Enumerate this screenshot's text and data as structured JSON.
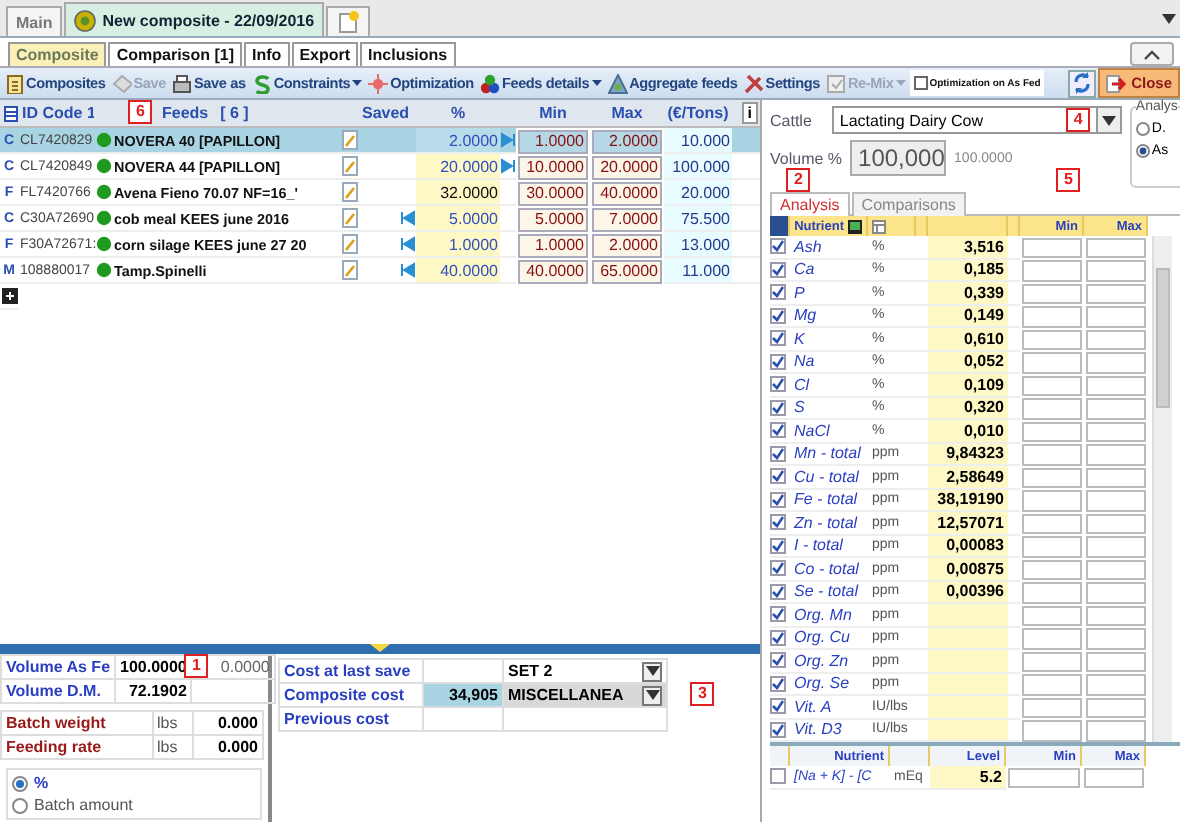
{
  "top_tabs": [
    {
      "label": "Main",
      "selected": false
    },
    {
      "label": "New composite - 22/09/2016",
      "selected": true
    }
  ],
  "sub_tabs": [
    {
      "label": "Composite",
      "selected": true
    },
    {
      "label": "Comparison [1]",
      "selected": false
    },
    {
      "label": "Info",
      "selected": false
    },
    {
      "label": "Export",
      "selected": false
    },
    {
      "label": "Inclusions",
      "selected": false
    }
  ],
  "toolbar": {
    "items": [
      {
        "label": "Composites",
        "kind": "composites",
        "disabled": false,
        "dropdown": false
      },
      {
        "label": "Save",
        "kind": "save",
        "disabled": true,
        "dropdown": false
      },
      {
        "label": "Save as",
        "kind": "saveas",
        "disabled": false,
        "dropdown": false
      },
      {
        "label": "Constraints",
        "kind": "constraints",
        "disabled": false,
        "dropdown": true
      },
      {
        "label": "Optimization",
        "kind": "optimization",
        "disabled": false,
        "dropdown": false
      },
      {
        "label": "Feeds details",
        "kind": "details",
        "disabled": false,
        "dropdown": true
      },
      {
        "label": "Aggregate feeds",
        "kind": "aggregate",
        "disabled": false,
        "dropdown": false
      },
      {
        "label": "Settings",
        "kind": "settings",
        "disabled": false,
        "dropdown": false
      },
      {
        "label": "Re-Mix",
        "kind": "remix",
        "disabled": true,
        "dropdown": true
      }
    ],
    "as_fed": {
      "label": "Optimization on As Fed",
      "checked": false
    },
    "close": "Close"
  },
  "feed_grid": {
    "columns": {
      "id": "ID Code 1",
      "feeds": "Feeds",
      "count": "[ 6 ]",
      "saved": "Saved",
      "pct": "%",
      "min": "Min",
      "max": "Max",
      "cost": "(€/Tons)",
      "info": "i"
    },
    "callout": "6",
    "rows": [
      {
        "type": "C",
        "id": "CL7420829",
        "name": "NOVERA 40 [PAPILLON]",
        "at_min": false,
        "at_max": true,
        "pct": "2.0000",
        "min": "1.0000",
        "max": "2.0000",
        "cost": "10.000",
        "selected": true
      },
      {
        "type": "C",
        "id": "CL7420849",
        "name": "NOVERA 44 [PAPILLON]",
        "at_min": false,
        "at_max": true,
        "pct": "20.0000",
        "min": "10.0000",
        "max": "20.0000",
        "cost": "100.000",
        "selected": false
      },
      {
        "type": "F",
        "id": "FL7420766",
        "name": "Avena Fieno 70.07 NF=16_'",
        "at_min": false,
        "at_max": false,
        "pct": "32.0000",
        "min": "30.0000",
        "max": "40.0000",
        "cost": "20.000",
        "selected": false
      },
      {
        "type": "C",
        "id": "C30A72690",
        "name": "cob meal KEES june 2016",
        "at_min": true,
        "at_max": false,
        "pct": "5.0000",
        "min": "5.0000",
        "max": "7.0000",
        "cost": "75.500",
        "selected": false
      },
      {
        "type": "F",
        "id": "F30A72671:",
        "name": "corn silage KEES june 27 20",
        "at_min": true,
        "at_max": false,
        "pct": "1.0000",
        "min": "1.0000",
        "max": "2.0000",
        "cost": "13.000",
        "selected": false
      },
      {
        "type": "M",
        "id": "108880017",
        "name": "Tamp.Spinelli",
        "at_min": true,
        "at_max": false,
        "pct": "40.0000",
        "min": "40.0000",
        "max": "65.0000",
        "cost": "11.000",
        "selected": false
      }
    ]
  },
  "volume_table": {
    "callout": "1",
    "rows": [
      {
        "label": "Volume As Fe",
        "value": "100.0000",
        "value_2": "0.0000"
      },
      {
        "label": "Volume D.M.",
        "value": "72.1902"
      }
    ]
  },
  "batch_table": [
    {
      "label": "Batch weight",
      "unit": "lbs",
      "value": "0.000"
    },
    {
      "label": "Feeding rate",
      "unit": "lbs",
      "value": "0.000"
    }
  ],
  "amount_mode": [
    {
      "label": "%",
      "selected": true
    },
    {
      "label": "Batch amount",
      "selected": false
    }
  ],
  "cost_table": {
    "callout": "3",
    "rows": [
      {
        "label": "Cost at last save",
        "set": "SET 2"
      },
      {
        "label": "Composite cost",
        "value": "34,905",
        "set": "MISCELLANEA"
      },
      {
        "label": "Previous cost"
      }
    ]
  },
  "animal": {
    "label": "Cattle",
    "value": "Lactating Dairy Cow",
    "callout": "4"
  },
  "volume": {
    "label": "Volume %",
    "value": "100,000",
    "reference": "100.0000"
  },
  "analysis_group": {
    "title": "Analys",
    "options": [
      {
        "label": "D.",
        "selected": false
      },
      {
        "label": "As",
        "selected": true
      }
    ]
  },
  "nutrient_tabs": [
    {
      "label": "Analysis",
      "selected": true,
      "callout": "2"
    },
    {
      "label": "Comparisons",
      "selected": false,
      "callout": "5"
    }
  ],
  "nutrient_grid": {
    "columns": {
      "nutrient": "Nutrient",
      "min": "Min",
      "max": "Max"
    },
    "rows": [
      {
        "name": "Ash",
        "unit": "%",
        "value": "3,516",
        "checked": true
      },
      {
        "name": "Ca",
        "unit": "%",
        "value": "0,185",
        "checked": true
      },
      {
        "name": "P",
        "unit": "%",
        "value": "0,339",
        "checked": true
      },
      {
        "name": "Mg",
        "unit": "%",
        "value": "0,149",
        "checked": true
      },
      {
        "name": "K",
        "unit": "%",
        "value": "0,610",
        "checked": true
      },
      {
        "name": "Na",
        "unit": "%",
        "value": "0,052",
        "checked": true
      },
      {
        "name": "Cl",
        "unit": "%",
        "value": "0,109",
        "checked": true
      },
      {
        "name": "S",
        "unit": "%",
        "value": "0,320",
        "checked": true
      },
      {
        "name": "NaCl",
        "unit": "%",
        "value": "0,010",
        "checked": true
      },
      {
        "name": "Mn - total",
        "unit": "ppm",
        "value": "9,84323",
        "checked": true
      },
      {
        "name": "Cu - total",
        "unit": "ppm",
        "value": "2,58649",
        "checked": true
      },
      {
        "name": "Fe - total",
        "unit": "ppm",
        "value": "38,19190",
        "checked": true
      },
      {
        "name": "Zn - total",
        "unit": "ppm",
        "value": "12,57071",
        "checked": true
      },
      {
        "name": "I - total",
        "unit": "ppm",
        "value": "0,00083",
        "checked": true
      },
      {
        "name": "Co - total",
        "unit": "ppm",
        "value": "0,00875",
        "checked": true
      },
      {
        "name": "Se - total",
        "unit": "ppm",
        "value": "0,00396",
        "checked": true
      },
      {
        "name": "Org. Mn",
        "unit": "ppm",
        "checked": true
      },
      {
        "name": "Org. Cu",
        "unit": "ppm",
        "checked": true
      },
      {
        "name": "Org. Zn",
        "unit": "ppm",
        "checked": true
      },
      {
        "name": "Org. Se",
        "unit": "ppm",
        "checked": true
      },
      {
        "name": "Vit. A",
        "unit": "IU/lbs",
        "checked": true
      },
      {
        "name": "Vit. D3",
        "unit": "IU/lbs",
        "checked": true
      }
    ]
  },
  "ratio_grid": {
    "columns": {
      "nutrient": "Nutrient",
      "level": "Level",
      "min": "Min",
      "max": "Max"
    },
    "rows": [
      {
        "name": "[Na + K] - [C",
        "unit": "mEq",
        "level": "5.2",
        "checked": false
      }
    ]
  }
}
